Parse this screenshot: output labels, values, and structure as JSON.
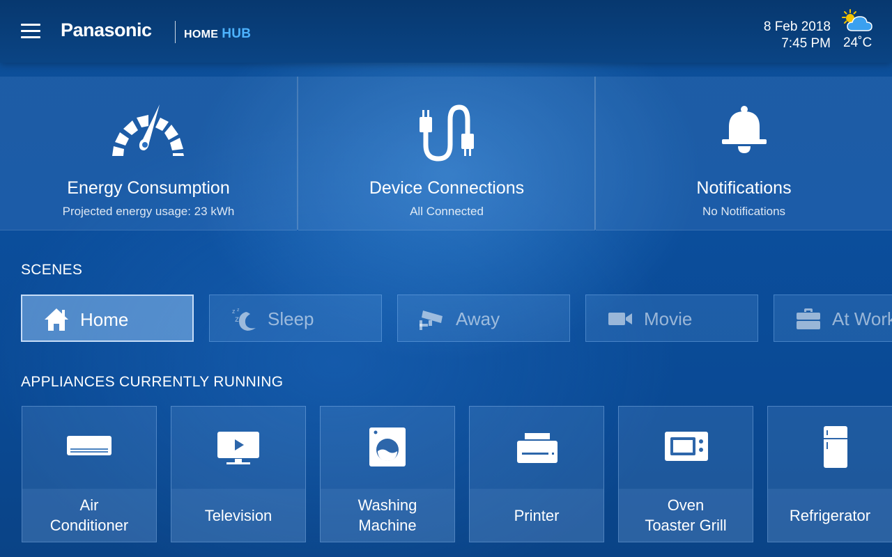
{
  "header": {
    "brand": "Panasonic",
    "product_home": "HOME",
    "product_hub": "HUB",
    "date": "8 Feb 2018",
    "time": "7:45 PM",
    "temperature": "24˚C",
    "weather_icon": "partly-cloudy-icon",
    "menu_icon": "hamburger-menu-icon"
  },
  "status_cards": [
    {
      "title": "Energy Consumption",
      "subtitle": "Projected energy usage: 23 kWh",
      "icon": "gauge-icon"
    },
    {
      "title": "Device Connections",
      "subtitle": "All Connected",
      "icon": "cable-icon"
    },
    {
      "title": "Notifications",
      "subtitle": "No Notifications",
      "icon": "bell-icon"
    }
  ],
  "scenes": {
    "title": "SCENES",
    "items": [
      {
        "label": "Home",
        "icon": "house-icon",
        "active": true
      },
      {
        "label": "Sleep",
        "icon": "moon-icon",
        "active": false
      },
      {
        "label": "Away",
        "icon": "security-camera-icon",
        "active": false
      },
      {
        "label": "Movie",
        "icon": "video-camera-icon",
        "active": false
      },
      {
        "label": "At Work",
        "icon": "briefcase-icon",
        "active": false
      }
    ]
  },
  "appliances": {
    "title": "APPLIANCES CURRENTLY RUNNING",
    "items": [
      {
        "line1": "Air",
        "line2": "Conditioner",
        "icon": "air-conditioner-icon"
      },
      {
        "line1": "Television",
        "line2": "",
        "icon": "television-icon"
      },
      {
        "line1": "Washing",
        "line2": "Machine",
        "icon": "washing-machine-icon"
      },
      {
        "line1": "Printer",
        "line2": "",
        "icon": "printer-icon"
      },
      {
        "line1": "Oven",
        "line2": "Toaster Grill",
        "icon": "oven-icon"
      },
      {
        "line1": "Refrigerator",
        "line2": "",
        "icon": "refrigerator-icon"
      }
    ]
  },
  "colors": {
    "accent": "#4db3ff",
    "background": "#0b4e9c",
    "header": "#07386f"
  }
}
